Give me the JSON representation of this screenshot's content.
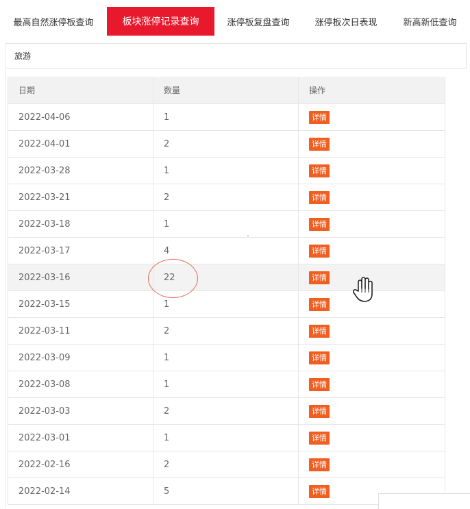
{
  "tabs": [
    {
      "label": "最高自然涨停板查询"
    },
    {
      "label": "板块涨停记录查询"
    },
    {
      "label": "涨停板复盘查询"
    },
    {
      "label": "涨停板次日表现"
    },
    {
      "label": "新高新低查询"
    }
  ],
  "sector": {
    "name": "旅游"
  },
  "table": {
    "headers": [
      "日期",
      "数量",
      "操作"
    ],
    "detail_label": "详情",
    "rows": [
      {
        "date": "2022-04-06",
        "count": "1"
      },
      {
        "date": "2022-04-01",
        "count": "2"
      },
      {
        "date": "2022-03-28",
        "count": "1"
      },
      {
        "date": "2022-03-21",
        "count": "2"
      },
      {
        "date": "2022-03-18",
        "count": "1"
      },
      {
        "date": "2022-03-17",
        "count": "4"
      },
      {
        "date": "2022-03-16",
        "count": "22"
      },
      {
        "date": "2022-03-15",
        "count": "1"
      },
      {
        "date": "2022-03-11",
        "count": "2"
      },
      {
        "date": "2022-03-09",
        "count": "1"
      },
      {
        "date": "2022-03-08",
        "count": "1"
      },
      {
        "date": "2022-03-03",
        "count": "2"
      },
      {
        "date": "2022-03-01",
        "count": "1"
      },
      {
        "date": "2022-02-16",
        "count": "2"
      },
      {
        "date": "2022-02-14",
        "count": "5"
      }
    ]
  },
  "colors": {
    "active_tab": "#e8192c",
    "detail_button": "#f05f21",
    "annotation_circle": "#e06a5a"
  }
}
